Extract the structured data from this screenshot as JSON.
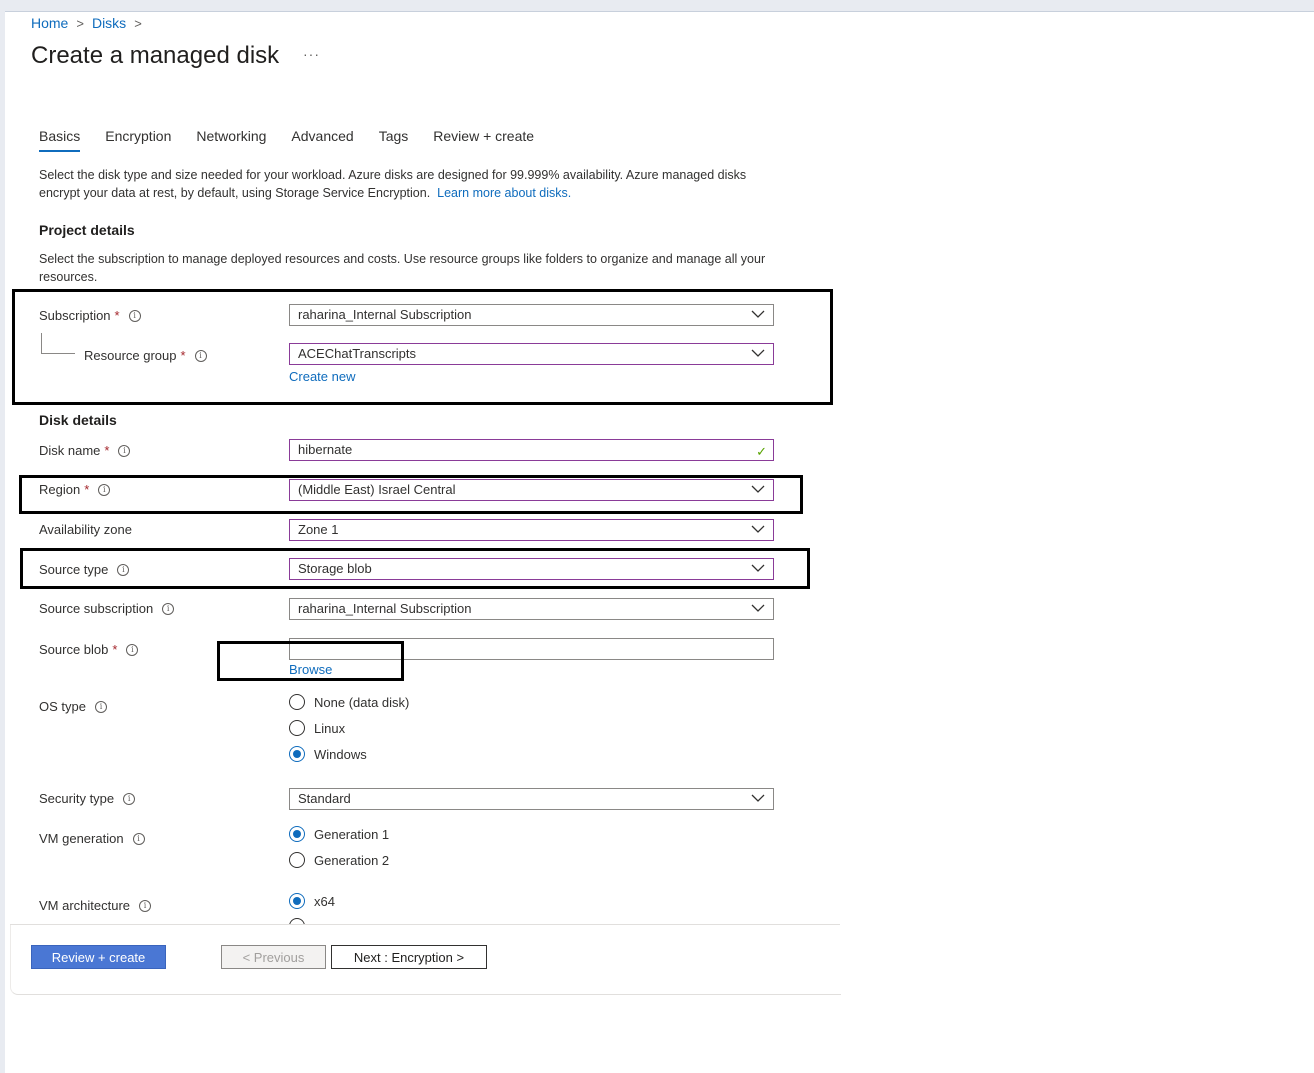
{
  "breadcrumb": {
    "items": [
      "Home",
      "Disks"
    ],
    "separator": ">"
  },
  "page": {
    "title": "Create a managed disk",
    "more": "···"
  },
  "tabs": [
    {
      "label": "Basics",
      "active": true
    },
    {
      "label": "Encryption"
    },
    {
      "label": "Networking"
    },
    {
      "label": "Advanced"
    },
    {
      "label": "Tags"
    },
    {
      "label": "Review + create"
    }
  ],
  "intro": {
    "text": "Select the disk type and size needed for your workload. Azure disks are designed for 99.999% availability. Azure managed disks encrypt your data at rest, by default, using Storage Service Encryption.",
    "link": "Learn more about disks."
  },
  "project": {
    "title": "Project details",
    "desc": "Select the subscription to manage deployed resources and costs. Use resource groups like folders to organize and manage all your resources.",
    "subscription": {
      "label": "Subscription",
      "value": "raharina_Internal Subscription"
    },
    "resource_group": {
      "label": "Resource group",
      "value": "ACEChatTranscripts",
      "create_new": "Create new"
    }
  },
  "disk": {
    "title": "Disk details",
    "disk_name": {
      "label": "Disk name",
      "value": "hibernate"
    },
    "region": {
      "label": "Region",
      "value": "(Middle East) Israel Central"
    },
    "availability_zone": {
      "label": "Availability zone",
      "value": "Zone 1"
    },
    "source_type": {
      "label": "Source type",
      "value": "Storage blob"
    },
    "source_subscription": {
      "label": "Source subscription",
      "value": "raharina_Internal Subscription"
    },
    "source_blob": {
      "label": "Source blob",
      "value": "",
      "browse": "Browse"
    },
    "os_type": {
      "label": "OS type",
      "options": [
        "None (data disk)",
        "Linux",
        "Windows"
      ],
      "selected": "Windows"
    },
    "security_type": {
      "label": "Security type",
      "value": "Standard"
    },
    "vm_generation": {
      "label": "VM generation",
      "options": [
        "Generation 1",
        "Generation 2"
      ],
      "selected": "Generation 1"
    },
    "vm_architecture": {
      "label": "VM architecture",
      "options": [
        "x64"
      ],
      "selected": "x64"
    }
  },
  "footer": {
    "review_create": "Review + create",
    "previous": "< Previous",
    "next": "Next : Encryption >"
  },
  "colors": {
    "accent": "#0f6cbd",
    "primary_button": "#4a77d4",
    "required": "#a4262c",
    "focus_border": "#8a3b98"
  }
}
